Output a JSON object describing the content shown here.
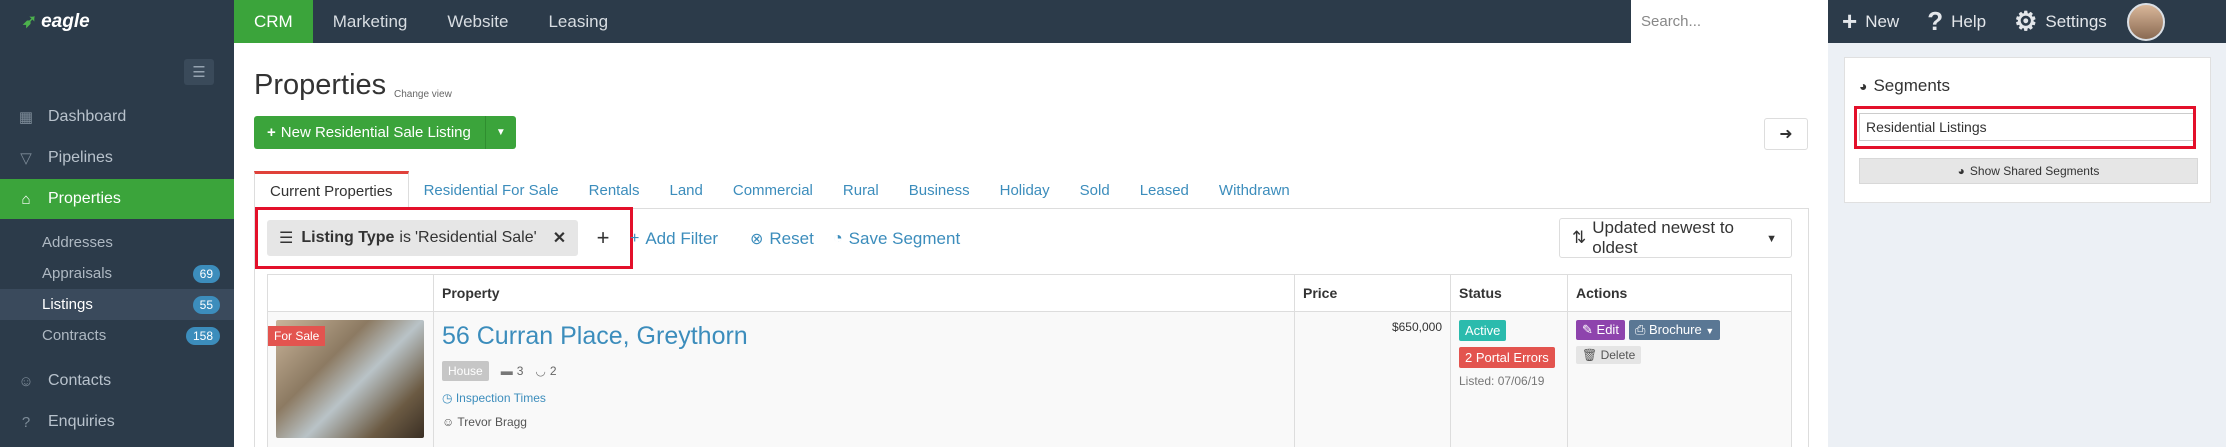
{
  "brand": {
    "name": "eagle"
  },
  "topnav": {
    "tabs": [
      "CRM",
      "Marketing",
      "Website",
      "Leasing"
    ]
  },
  "search": {
    "placeholder": "Search..."
  },
  "topright": {
    "new_label": "New",
    "help_label": "Help",
    "settings_label": "Settings"
  },
  "sidebar": {
    "items": [
      {
        "label": "Dashboard",
        "icon": "dashboard-icon"
      },
      {
        "label": "Pipelines",
        "icon": "filter-icon"
      },
      {
        "label": "Properties",
        "icon": "home-icon"
      },
      {
        "label": "Contacts",
        "icon": "user-icon"
      },
      {
        "label": "Enquiries",
        "icon": "question-icon"
      }
    ],
    "sub": [
      {
        "label": "Addresses"
      },
      {
        "label": "Appraisals",
        "badge": "69"
      },
      {
        "label": "Listings",
        "badge": "55"
      },
      {
        "label": "Contracts",
        "badge": "158"
      }
    ]
  },
  "page": {
    "title": "Properties",
    "change_view": "Change view",
    "new_button": "New Residential Sale Listing"
  },
  "tabs": [
    "Current Properties",
    "Residential For Sale",
    "Rentals",
    "Land",
    "Commercial",
    "Rural",
    "Business",
    "Holiday",
    "Sold",
    "Leased",
    "Withdrawn"
  ],
  "filter": {
    "field": "Listing Type",
    "op": "is",
    "value": "'Residential Sale'",
    "add_filter": "Add Filter",
    "reset": "Reset",
    "save_segment": "Save Segment",
    "sort": "Updated newest to oldest"
  },
  "table": {
    "headers": [
      "",
      "Property",
      "Price",
      "Status",
      "Actions"
    ],
    "rows": [
      {
        "badge": "For Sale",
        "address": "56 Curran Place, Greythorn",
        "type": "House",
        "beds": "3",
        "baths": "2",
        "inspection": "Inspection Times",
        "agent": "Trevor Bragg",
        "price": "$650,000",
        "status": "Active",
        "portal_errors": "2 Portal Errors",
        "listed": "Listed: 07/06/19",
        "edit": "Edit",
        "brochure": "Brochure",
        "delete": "Delete"
      }
    ]
  },
  "segments": {
    "title": "Segments",
    "input_value": "Residential Listings",
    "show_shared": "Show Shared Segments"
  }
}
